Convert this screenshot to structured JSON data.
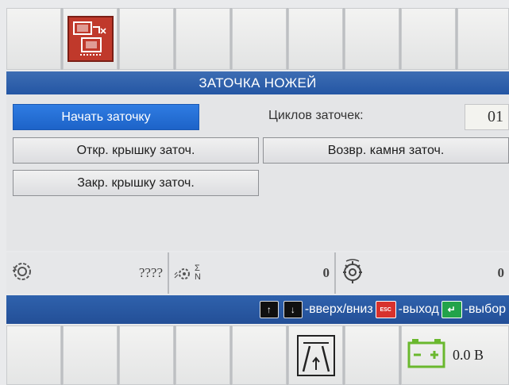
{
  "title": "ЗАТОЧКА НОЖЕЙ",
  "buttons": {
    "start": "Начать заточку",
    "open_cover": "Откр. крышку заточ.",
    "close_cover": "Закр. крышку заточ.",
    "return_stone": "Возвр. камня заточ."
  },
  "cycles": {
    "label": "Циклов заточек:",
    "value": "01"
  },
  "status": {
    "field1": "????",
    "sum_label": "Σ",
    "sum_sub": "N",
    "field2": "0",
    "field3": "0"
  },
  "nav": {
    "updown": "-вверх/вниз",
    "esc_key": "ESC",
    "exit": "-выход",
    "select": "-выбор"
  },
  "battery": {
    "value": "0.0 В"
  },
  "colors": {
    "accent": "#2456a4",
    "active_button": "#1d63c8",
    "icon_red": "#c0392b",
    "battery_green": "#6ab82e"
  },
  "icons": [
    "sharpening-device-icon",
    "arrow-up-icon",
    "arrow-down-icon",
    "esc-key-icon",
    "enter-key-icon",
    "road-lane-icon",
    "battery-icon",
    "rotation-icon",
    "gear-sum-icon",
    "knife-drum-icon"
  ]
}
